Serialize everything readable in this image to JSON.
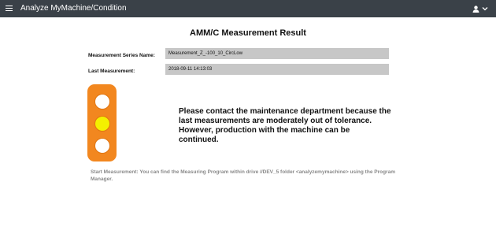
{
  "header": {
    "app_title": "Analyze MyMachine/Condition",
    "menu_icon": "hamburger-icon",
    "user_icon": "user-icon",
    "dropdown_icon": "chevron-down-icon"
  },
  "main": {
    "title": "AMM/C Measurement Result",
    "fields": [
      {
        "label": "Measurement Series Name:",
        "value": "Measurement_Z_-100_10_CircLow"
      },
      {
        "label": "Last Measurement:",
        "value": "2018-09-11 14:13:03"
      }
    ],
    "status": {
      "level": "yellow",
      "lamps": [
        "red-off",
        "yellow-on",
        "green-off"
      ],
      "colors": {
        "housing": "#f2871f",
        "active": "#f4f000",
        "inactive": "#ffffff"
      }
    },
    "message": "Please contact the maintenance department because the last measurements are moderately out of tolerance. However, production with the machine can be continued.",
    "hint": "Start Measurement: You can find the Measuring Program within drive //DEV_5 folder <analyzemymachine> using the Program Manager."
  },
  "theme": {
    "header_bg": "#3a4148",
    "field_bg": "#c7c7c7",
    "hint_color": "#8a8a8a"
  }
}
